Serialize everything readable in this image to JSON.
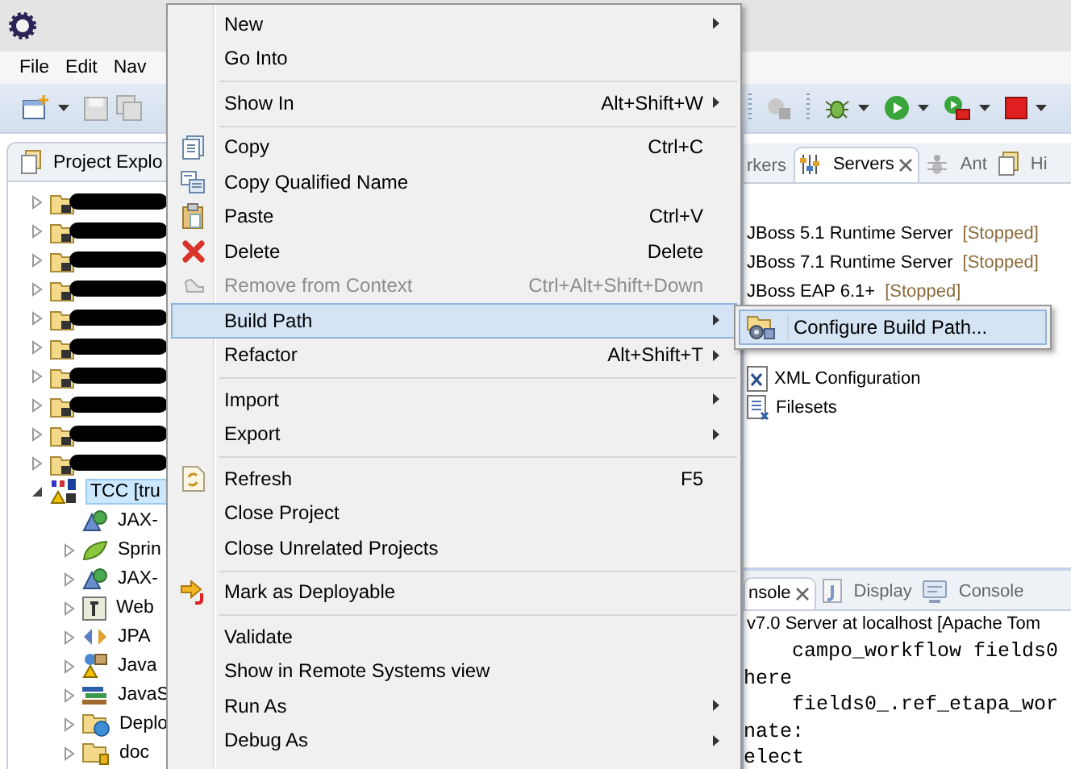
{
  "menu_bar": [
    "File",
    "Edit",
    "Nav"
  ],
  "project_explorer": {
    "tab": "Project Explo",
    "items": [
      {
        "redacted": true,
        "expanded": false,
        "selected": false
      },
      {
        "redacted": true,
        "expanded": false,
        "selected": false
      },
      {
        "redacted": true,
        "expanded": false,
        "selected": false
      },
      {
        "redacted": true,
        "expanded": false,
        "selected": false
      },
      {
        "redacted": true,
        "expanded": false,
        "selected": false
      },
      {
        "redacted": true,
        "expanded": false,
        "selected": false
      },
      {
        "redacted": true,
        "expanded": false,
        "selected": false
      },
      {
        "redacted": true,
        "expanded": false,
        "selected": false
      },
      {
        "redacted": true,
        "expanded": false,
        "selected": false
      },
      {
        "redacted": true,
        "expanded": false,
        "selected": false
      },
      {
        "label": "TCC [tru",
        "expanded": true,
        "selected": true,
        "children": [
          {
            "label": "JAX-",
            "expandable": false
          },
          {
            "label": "Sprin",
            "expandable": true
          },
          {
            "label": "JAX-",
            "expandable": true
          },
          {
            "label": "Web",
            "expandable": true
          },
          {
            "label": "JPA",
            "expandable": true
          },
          {
            "label": "Java",
            "expandable": true
          },
          {
            "label": "JavaS",
            "expandable": true
          },
          {
            "label": "Deplo",
            "expandable": true
          },
          {
            "label": "doc",
            "expandable": true
          }
        ]
      }
    ]
  },
  "servers_view": {
    "tabs": [
      {
        "label": "rkers",
        "selected": false,
        "closable": false
      },
      {
        "label": "Servers",
        "selected": true,
        "closable": true
      },
      {
        "label": "Ant",
        "selected": false,
        "closable": false
      },
      {
        "label": "Hi",
        "selected": false,
        "closable": false
      }
    ],
    "servers": [
      {
        "name": "JBoss 5.1 Runtime Server",
        "status": "[Stopped]"
      },
      {
        "name": "JBoss 7.1 Runtime Server",
        "status": "[Stopped]"
      },
      {
        "name": "JBoss EAP 6.1+",
        "status": "[Stopped]"
      }
    ],
    "resources": [
      "XML Configuration",
      "Filesets"
    ]
  },
  "console_view": {
    "tabs": [
      {
        "label": "nsole",
        "selected": true,
        "closable": true
      },
      {
        "label": "Display",
        "selected": false,
        "closable": false
      },
      {
        "label": "Console",
        "selected": false,
        "closable": false
      }
    ],
    "header": "v7.0 Server at localhost [Apache Tom",
    "lines": [
      "    campo_workflow fields0",
      "here",
      "    fields0_.ref_etapa_wor",
      "nate:",
      "elect"
    ]
  },
  "context_menu": {
    "items": [
      {
        "kind": "item",
        "label": "New",
        "submenu": true,
        "disabled": false,
        "selected": false
      },
      {
        "kind": "item",
        "label": "Go Into",
        "submenu": false,
        "disabled": false,
        "selected": false
      },
      {
        "kind": "separator"
      },
      {
        "kind": "item",
        "label": "Show In",
        "shortcut": "Alt+Shift+W",
        "submenu": true,
        "disabled": false,
        "selected": false
      },
      {
        "kind": "separator"
      },
      {
        "kind": "item",
        "label": "Copy",
        "shortcut": "Ctrl+C",
        "submenu": false,
        "disabled": false,
        "selected": false
      },
      {
        "kind": "item",
        "label": "Copy Qualified Name",
        "submenu": false,
        "disabled": false,
        "selected": false
      },
      {
        "kind": "item",
        "label": "Paste",
        "shortcut": "Ctrl+V",
        "submenu": false,
        "disabled": false,
        "selected": false
      },
      {
        "kind": "item",
        "label": "Delete",
        "shortcut": "Delete",
        "submenu": false,
        "disabled": false,
        "selected": false
      },
      {
        "kind": "item",
        "label": "Remove from Context",
        "shortcut": "Ctrl+Alt+Shift+Down",
        "submenu": false,
        "disabled": true,
        "selected": false
      },
      {
        "kind": "item",
        "label": "Build Path",
        "submenu": true,
        "disabled": false,
        "selected": true
      },
      {
        "kind": "item",
        "label": "Refactor",
        "shortcut": "Alt+Shift+T",
        "submenu": true,
        "disabled": false,
        "selected": false
      },
      {
        "kind": "separator"
      },
      {
        "kind": "item",
        "label": "Import",
        "submenu": true,
        "disabled": false,
        "selected": false
      },
      {
        "kind": "item",
        "label": "Export",
        "submenu": true,
        "disabled": false,
        "selected": false
      },
      {
        "kind": "separator"
      },
      {
        "kind": "item",
        "label": "Refresh",
        "shortcut": "F5",
        "submenu": false,
        "disabled": false,
        "selected": false
      },
      {
        "kind": "item",
        "label": "Close Project",
        "submenu": false,
        "disabled": false,
        "selected": false
      },
      {
        "kind": "item",
        "label": "Close Unrelated Projects",
        "submenu": false,
        "disabled": false,
        "selected": false
      },
      {
        "kind": "separator"
      },
      {
        "kind": "item",
        "label": "Mark as Deployable",
        "submenu": false,
        "disabled": false,
        "selected": false
      },
      {
        "kind": "separator"
      },
      {
        "kind": "item",
        "label": "Validate",
        "submenu": false,
        "disabled": false,
        "selected": false
      },
      {
        "kind": "item",
        "label": "Show in Remote Systems view",
        "submenu": false,
        "disabled": false,
        "selected": false
      },
      {
        "kind": "item",
        "label": "Run As",
        "submenu": true,
        "disabled": false,
        "selected": false
      },
      {
        "kind": "item",
        "label": "Debug As",
        "submenu": true,
        "disabled": false,
        "selected": false
      }
    ]
  },
  "submenu": {
    "items": [
      {
        "label": "Configure Build Path...",
        "selected": true
      }
    ]
  }
}
